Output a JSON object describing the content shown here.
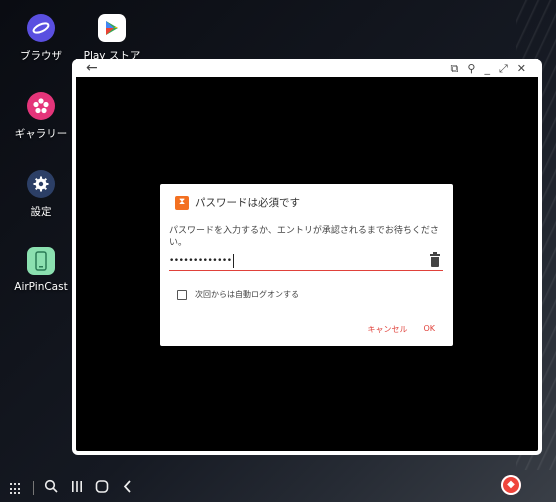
{
  "desktop": {
    "apps": [
      {
        "label": "ブラウザ",
        "icon": "browser-icon"
      },
      {
        "label": "Play ストア",
        "icon": "play-store-icon"
      },
      {
        "label": "ギャラリー",
        "icon": "gallery-icon"
      },
      {
        "label": "設定",
        "icon": "settings-gear-icon"
      },
      {
        "label": "AirPinCast",
        "icon": "airpincast-icon"
      }
    ]
  },
  "window": {
    "back_glyph": "←",
    "controls": [
      "⧉",
      "⚲",
      "_",
      "⤢",
      "✕"
    ]
  },
  "dialog": {
    "title": "パスワードは必須です",
    "message": "パスワードを入力するか、エントリが承認されるまでお待ちください。",
    "password_value": "•••••••••••••",
    "checkbox_label": "次回からは自動ログオンする",
    "checkbox_checked": false,
    "cancel_label": "キャンセル",
    "ok_label": "OK"
  },
  "taskbar": {
    "items": [
      "apps-grid-icon",
      "search-icon",
      "recents-icon",
      "home-icon",
      "back-icon",
      "anydesk-icon"
    ]
  },
  "colors": {
    "accent_red": "#e0413a",
    "hourglass_orange": "#f37021",
    "browser_purple": "#5a4fe0",
    "gallery_pink": "#e4357a",
    "settings_blue": "#2c3f66",
    "airpincast_green": "#8be0b0"
  }
}
